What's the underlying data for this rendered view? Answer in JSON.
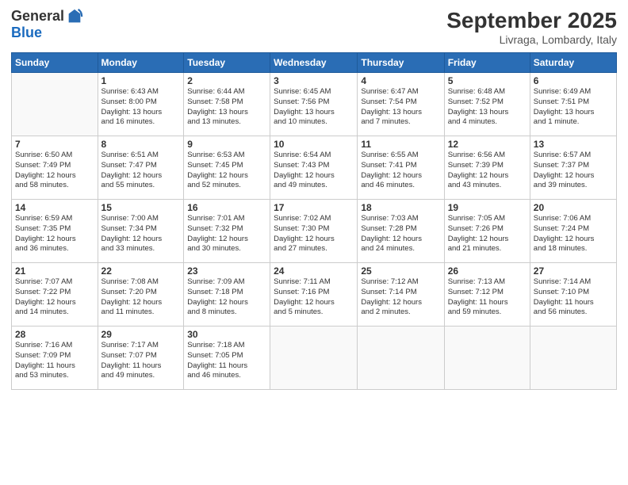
{
  "header": {
    "logo_general": "General",
    "logo_blue": "Blue",
    "month": "September 2025",
    "location": "Livraga, Lombardy, Italy"
  },
  "weekdays": [
    "Sunday",
    "Monday",
    "Tuesday",
    "Wednesday",
    "Thursday",
    "Friday",
    "Saturday"
  ],
  "weeks": [
    [
      {
        "date": "",
        "info": ""
      },
      {
        "date": "1",
        "info": "Sunrise: 6:43 AM\nSunset: 8:00 PM\nDaylight: 13 hours\nand 16 minutes."
      },
      {
        "date": "2",
        "info": "Sunrise: 6:44 AM\nSunset: 7:58 PM\nDaylight: 13 hours\nand 13 minutes."
      },
      {
        "date": "3",
        "info": "Sunrise: 6:45 AM\nSunset: 7:56 PM\nDaylight: 13 hours\nand 10 minutes."
      },
      {
        "date": "4",
        "info": "Sunrise: 6:47 AM\nSunset: 7:54 PM\nDaylight: 13 hours\nand 7 minutes."
      },
      {
        "date": "5",
        "info": "Sunrise: 6:48 AM\nSunset: 7:52 PM\nDaylight: 13 hours\nand 4 minutes."
      },
      {
        "date": "6",
        "info": "Sunrise: 6:49 AM\nSunset: 7:51 PM\nDaylight: 13 hours\nand 1 minute."
      }
    ],
    [
      {
        "date": "7",
        "info": "Sunrise: 6:50 AM\nSunset: 7:49 PM\nDaylight: 12 hours\nand 58 minutes."
      },
      {
        "date": "8",
        "info": "Sunrise: 6:51 AM\nSunset: 7:47 PM\nDaylight: 12 hours\nand 55 minutes."
      },
      {
        "date": "9",
        "info": "Sunrise: 6:53 AM\nSunset: 7:45 PM\nDaylight: 12 hours\nand 52 minutes."
      },
      {
        "date": "10",
        "info": "Sunrise: 6:54 AM\nSunset: 7:43 PM\nDaylight: 12 hours\nand 49 minutes."
      },
      {
        "date": "11",
        "info": "Sunrise: 6:55 AM\nSunset: 7:41 PM\nDaylight: 12 hours\nand 46 minutes."
      },
      {
        "date": "12",
        "info": "Sunrise: 6:56 AM\nSunset: 7:39 PM\nDaylight: 12 hours\nand 43 minutes."
      },
      {
        "date": "13",
        "info": "Sunrise: 6:57 AM\nSunset: 7:37 PM\nDaylight: 12 hours\nand 39 minutes."
      }
    ],
    [
      {
        "date": "14",
        "info": "Sunrise: 6:59 AM\nSunset: 7:35 PM\nDaylight: 12 hours\nand 36 minutes."
      },
      {
        "date": "15",
        "info": "Sunrise: 7:00 AM\nSunset: 7:34 PM\nDaylight: 12 hours\nand 33 minutes."
      },
      {
        "date": "16",
        "info": "Sunrise: 7:01 AM\nSunset: 7:32 PM\nDaylight: 12 hours\nand 30 minutes."
      },
      {
        "date": "17",
        "info": "Sunrise: 7:02 AM\nSunset: 7:30 PM\nDaylight: 12 hours\nand 27 minutes."
      },
      {
        "date": "18",
        "info": "Sunrise: 7:03 AM\nSunset: 7:28 PM\nDaylight: 12 hours\nand 24 minutes."
      },
      {
        "date": "19",
        "info": "Sunrise: 7:05 AM\nSunset: 7:26 PM\nDaylight: 12 hours\nand 21 minutes."
      },
      {
        "date": "20",
        "info": "Sunrise: 7:06 AM\nSunset: 7:24 PM\nDaylight: 12 hours\nand 18 minutes."
      }
    ],
    [
      {
        "date": "21",
        "info": "Sunrise: 7:07 AM\nSunset: 7:22 PM\nDaylight: 12 hours\nand 14 minutes."
      },
      {
        "date": "22",
        "info": "Sunrise: 7:08 AM\nSunset: 7:20 PM\nDaylight: 12 hours\nand 11 minutes."
      },
      {
        "date": "23",
        "info": "Sunrise: 7:09 AM\nSunset: 7:18 PM\nDaylight: 12 hours\nand 8 minutes."
      },
      {
        "date": "24",
        "info": "Sunrise: 7:11 AM\nSunset: 7:16 PM\nDaylight: 12 hours\nand 5 minutes."
      },
      {
        "date": "25",
        "info": "Sunrise: 7:12 AM\nSunset: 7:14 PM\nDaylight: 12 hours\nand 2 minutes."
      },
      {
        "date": "26",
        "info": "Sunrise: 7:13 AM\nSunset: 7:12 PM\nDaylight: 11 hours\nand 59 minutes."
      },
      {
        "date": "27",
        "info": "Sunrise: 7:14 AM\nSunset: 7:10 PM\nDaylight: 11 hours\nand 56 minutes."
      }
    ],
    [
      {
        "date": "28",
        "info": "Sunrise: 7:16 AM\nSunset: 7:09 PM\nDaylight: 11 hours\nand 53 minutes."
      },
      {
        "date": "29",
        "info": "Sunrise: 7:17 AM\nSunset: 7:07 PM\nDaylight: 11 hours\nand 49 minutes."
      },
      {
        "date": "30",
        "info": "Sunrise: 7:18 AM\nSunset: 7:05 PM\nDaylight: 11 hours\nand 46 minutes."
      },
      {
        "date": "",
        "info": ""
      },
      {
        "date": "",
        "info": ""
      },
      {
        "date": "",
        "info": ""
      },
      {
        "date": "",
        "info": ""
      }
    ]
  ]
}
